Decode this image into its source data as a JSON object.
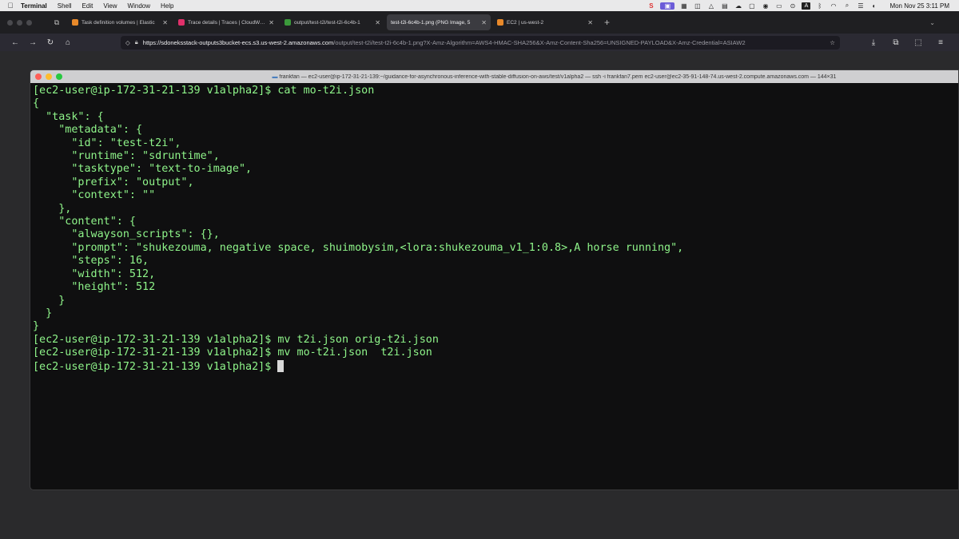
{
  "menubar": {
    "items": [
      "Terminal",
      "Shell",
      "Edit",
      "View",
      "Window",
      "Help"
    ],
    "clock": "Mon Nov 25  3:11 PM"
  },
  "tabs": [
    {
      "title": "Task definition volumes | Elastic",
      "color": "#e8892a"
    },
    {
      "title": "Trace details | Traces | CloudWatch",
      "color": "#e0306a"
    },
    {
      "title": "output/test-t2i/test-t2i-6c4b-1",
      "color": "#3b9a3b"
    },
    {
      "title": "test-t2i-6c4b-1.png (PNG Image, 5",
      "color": "#888888"
    },
    {
      "title": "EC2 | us-west-2",
      "color": "#e8892a"
    }
  ],
  "url": {
    "host": "https://sdoneksstack-outputs3bucket-ecs.s3.us-west-2.amazonaws.com",
    "path": "/output/test-t2i/test-t2i-6c4b-1.png?X-Amz-Algorithm=AWS4-HMAC-SHA256&X-Amz-Content-Sha256=UNSIGNED-PAYLOAD&X-Amz-Credential=ASIAW2"
  },
  "terminal": {
    "title": "frankfan — ec2-user@ip-172-31-21-139:~/guidance-for-asynchronous-inference-with-stable-diffusion-on-aws/test/v1alpha2 — ssh -i frankfan7.pem ec2-user@ec2-35-91-148-74.us-west-2.compute.amazonaws.com — 144×31",
    "lines": [
      "[ec2-user@ip-172-31-21-139 v1alpha2]$ cat mo-t2i.json",
      "{",
      "  \"task\": {",
      "    \"metadata\": {",
      "      \"id\": \"test-t2i\",",
      "      \"runtime\": \"sdruntime\",",
      "      \"tasktype\": \"text-to-image\",",
      "      \"prefix\": \"output\",",
      "      \"context\": \"\"",
      "    },",
      "    \"content\": {",
      "      \"alwayson_scripts\": {},",
      "      \"prompt\": \"shukezouma, negative space, shuimobysim,<lora:shukezouma_v1_1:0.8>,A horse running\",",
      "      \"steps\": 16,",
      "      \"width\": 512,",
      "      \"height\": 512",
      "    }",
      "  }",
      "}",
      "[ec2-user@ip-172-31-21-139 v1alpha2]$ mv t2i.json orig-t2i.json",
      "[ec2-user@ip-172-31-21-139 v1alpha2]$ mv mo-t2i.json  t2i.json"
    ],
    "prompt": "[ec2-user@ip-172-31-21-139 v1alpha2]$ "
  }
}
